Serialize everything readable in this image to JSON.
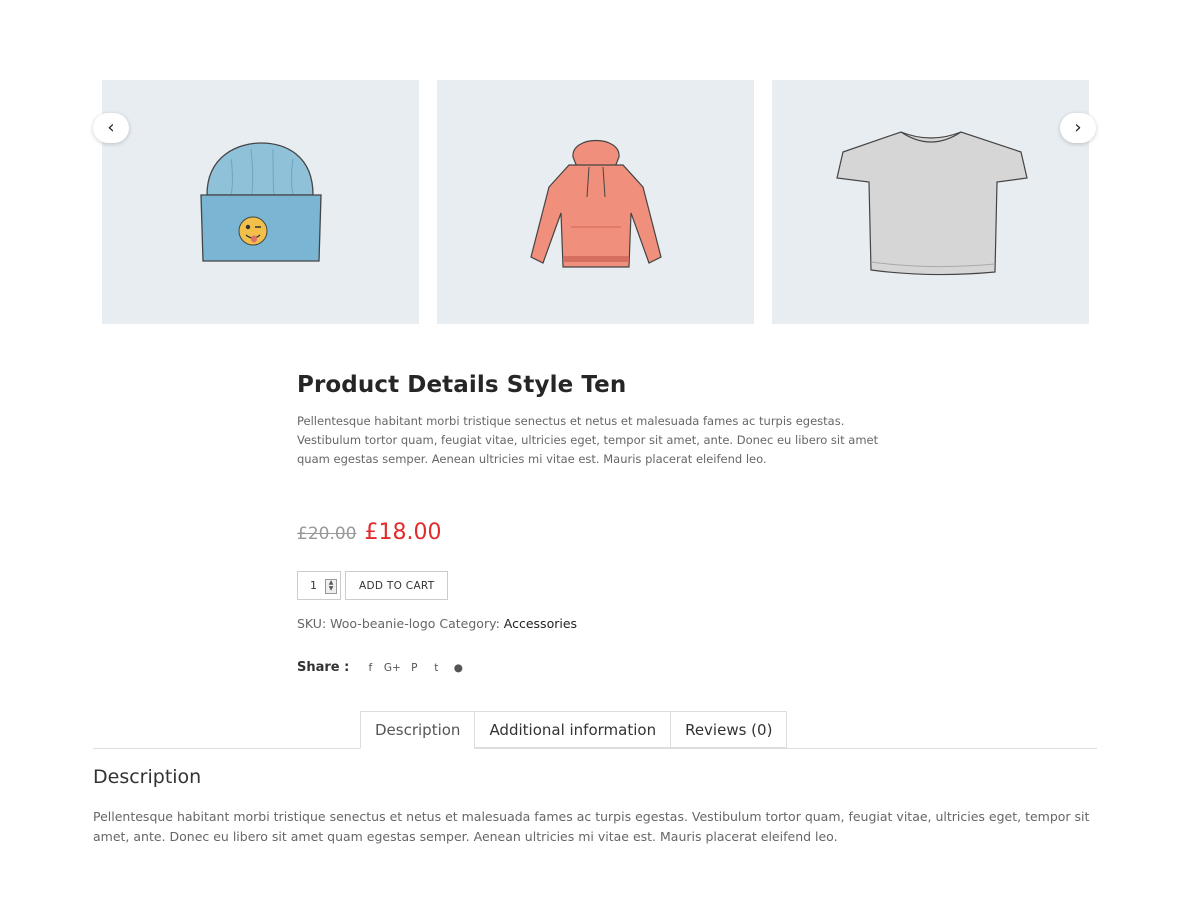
{
  "carousel": {
    "prev_icon": "chevron-left-icon",
    "next_icon": "chevron-right-icon",
    "slides": [
      {
        "name": "beanie-with-emoji-logo",
        "color": "#8fc1d9"
      },
      {
        "name": "hoodie",
        "color": "#f08f7c"
      },
      {
        "name": "t-shirt",
        "color": "#d6d6d6"
      }
    ]
  },
  "product": {
    "title": "Product Details Style Ten",
    "short_description": "Pellentesque habitant morbi tristique senectus et netus et malesuada fames ac turpis egestas. Vestibulum tortor quam, feugiat vitae, ultricies eget, tempor sit amet, ante. Donec eu libero sit amet quam egestas semper. Aenean ultricies mi vitae est. Mauris placerat eleifend leo.",
    "old_price": "£20.00",
    "price": "£18.00",
    "price_color": "#e22c2c",
    "quantity": "1",
    "add_to_cart_label": "ADD TO CART",
    "sku_label": "SKU:",
    "sku": "Woo-beanie-logo",
    "category_label": "Category:",
    "category": "Accessories"
  },
  "share": {
    "label": "Share :",
    "icons": [
      {
        "name": "facebook-icon",
        "glyph": "f"
      },
      {
        "name": "google-plus-icon",
        "glyph": "G+"
      },
      {
        "name": "pinterest-icon",
        "glyph": "P"
      },
      {
        "name": "twitter-icon",
        "glyph": "t"
      },
      {
        "name": "reddit-icon",
        "glyph": "●"
      }
    ]
  },
  "tabs": [
    {
      "label": "Description",
      "active": true
    },
    {
      "label": "Additional information",
      "active": false
    },
    {
      "label": "Reviews (0)",
      "active": false
    }
  ],
  "panel": {
    "title": "Description",
    "text": "Pellentesque habitant morbi tristique senectus et netus et malesuada fames ac turpis egestas. Vestibulum tortor quam, feugiat vitae, ultricies eget, tempor sit amet, ante. Donec eu libero sit amet quam egestas semper. Aenean ultricies mi vitae est. Mauris placerat eleifend leo."
  }
}
